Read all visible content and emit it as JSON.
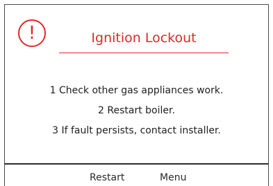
{
  "alert": {
    "icon": "exclamation-circle-icon",
    "glyph": "!",
    "title": "Ignition Lockout",
    "accent_color": "#e3262a"
  },
  "steps": [
    "1 Check other gas appliances work.",
    "2 Restart boiler.",
    "3 If fault persists, contact installer."
  ],
  "softkeys": {
    "restart_label": "Restart",
    "menu_label": "Menu"
  }
}
